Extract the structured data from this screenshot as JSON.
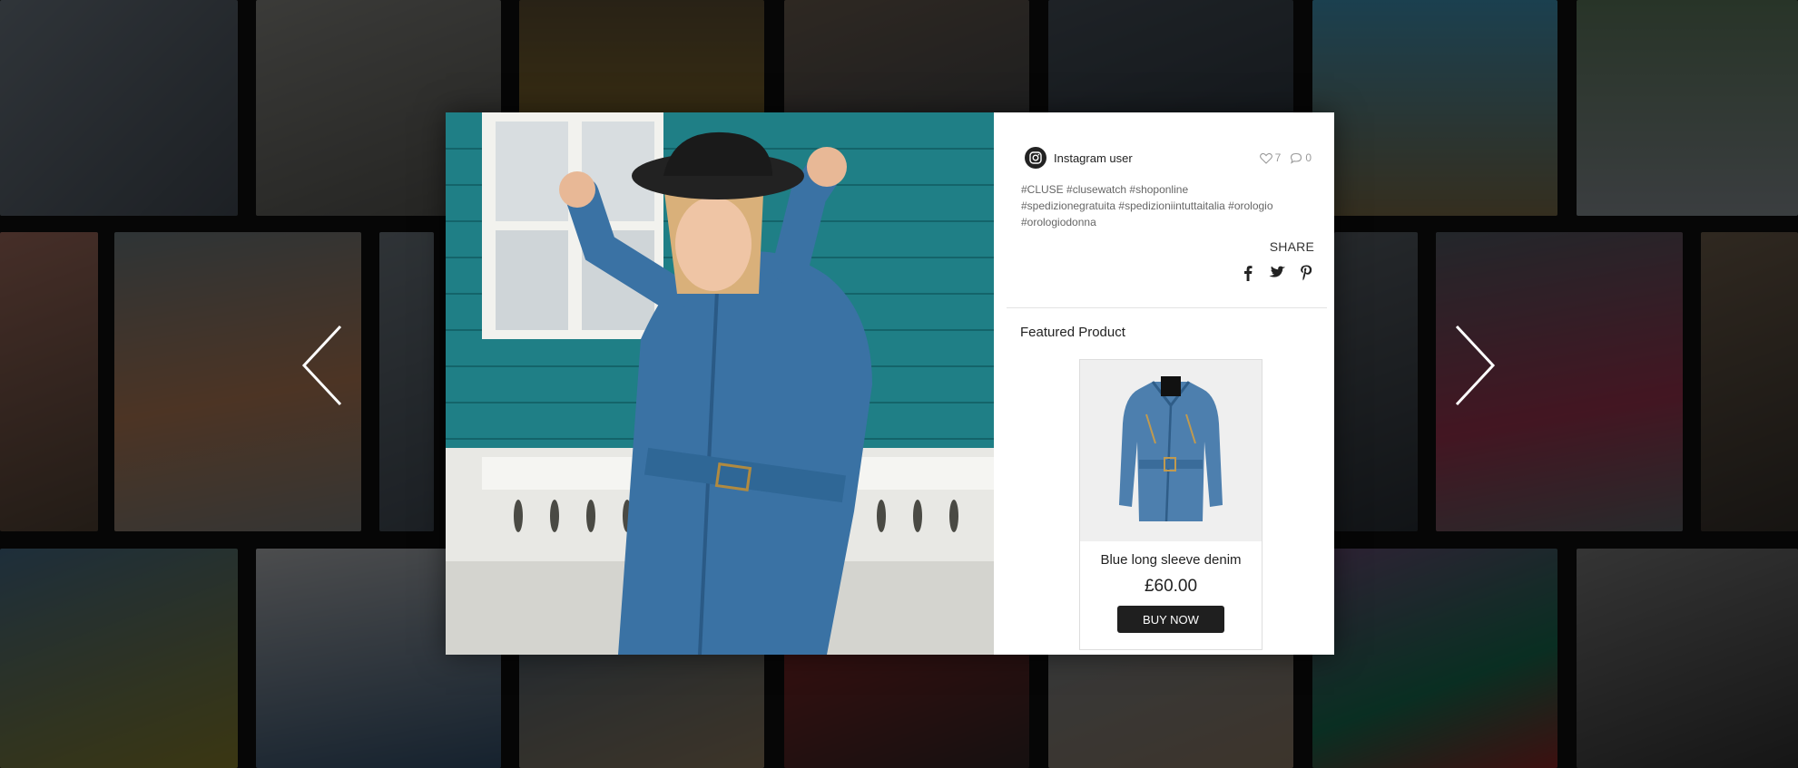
{
  "post": {
    "user_name": "Instagram user",
    "likes": "7",
    "comments": "0",
    "caption": "#CLUSE #clusewatch #shoponline #spedizionegratuita #spedizioniintuttaitalia #orologio #orologiodonna",
    "share_label": "SHARE"
  },
  "featured": {
    "title": "Featured Product",
    "product_name": "Blue long sleeve denim",
    "price": "£60.00",
    "buy_label": "BUY NOW"
  },
  "colors": {
    "overlay": "#000000",
    "button_bg": "#1f1f1f",
    "teal_wall": "#1f7f86",
    "denim": "#3a72a4"
  }
}
